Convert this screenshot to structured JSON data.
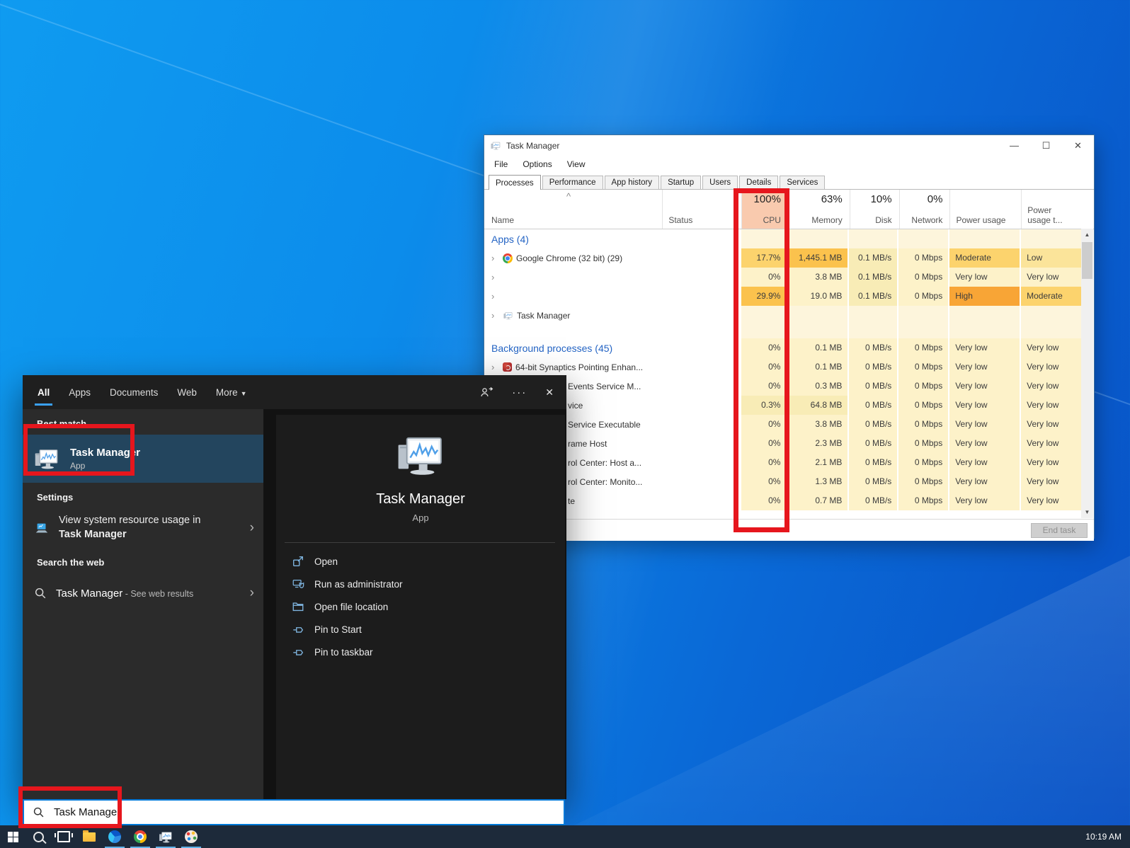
{
  "colors": {
    "accent_blue": "#0078d7",
    "annotation_red": "#e6161d",
    "selection_blue": "#23455e",
    "taskbar_bg": "#1d2a3a",
    "cpu_header_bg": "#f9caae",
    "heat_levels": {
      "empty": "#fdf5dc",
      "very_low": "#fdf2c9",
      "low2": "#f8ecb6",
      "low": "#fbe49a",
      "moderate": "#fcd36d",
      "strong": "#fbc24d",
      "high": "#f8a536"
    }
  },
  "task_manager": {
    "window_title": "Task Manager",
    "window_controls": {
      "minimize": "—",
      "maximize": "☐",
      "close": "✕"
    },
    "menu": [
      "File",
      "Options",
      "View"
    ],
    "tabs": [
      {
        "label": "Processes",
        "active": true
      },
      {
        "label": "Performance"
      },
      {
        "label": "App history"
      },
      {
        "label": "Startup"
      },
      {
        "label": "Users"
      },
      {
        "label": "Details"
      },
      {
        "label": "Services"
      }
    ],
    "columns": {
      "sort_indicator": "^",
      "name": "Name",
      "status": "Status",
      "cpu_pct": "100%",
      "cpu": "CPU",
      "memory_pct": "63%",
      "memory": "Memory",
      "disk_pct": "10%",
      "disk": "Disk",
      "network_pct": "0%",
      "network": "Network",
      "power": "Power usage",
      "power_trend": "Power usage t..."
    },
    "scrollbar": {
      "up": "▲",
      "down": "▼"
    },
    "rows": [
      {
        "kind": "section",
        "name": "Apps (4)",
        "cells": [
          [
            "",
            "l0"
          ],
          [
            "",
            "l0"
          ],
          [
            "",
            "l0"
          ],
          [
            "",
            "l0"
          ],
          [
            "",
            "l0"
          ],
          [
            "",
            "l0"
          ]
        ]
      },
      {
        "kind": "proc",
        "chevron": true,
        "icon": "chrome-icon",
        "name": "Google Chrome (32 bit) (29)",
        "cells": [
          [
            "17.7%",
            "l3"
          ],
          [
            "1,445.1 MB",
            "l4"
          ],
          [
            "0.1 MB/s",
            "l2"
          ],
          [
            "0 Mbps",
            "l1"
          ],
          [
            "Moderate",
            "l3"
          ],
          [
            "Low",
            "l25"
          ]
        ]
      },
      {
        "kind": "proc",
        "chevron": true,
        "name": "",
        "cells": [
          [
            "0%",
            "l1"
          ],
          [
            "3.8 MB",
            "l1"
          ],
          [
            "0.1 MB/s",
            "l2"
          ],
          [
            "0 Mbps",
            "l1"
          ],
          [
            "Very low",
            "l1"
          ],
          [
            "Very low",
            "l1"
          ]
        ]
      },
      {
        "kind": "proc",
        "chevron": true,
        "name": "",
        "cells": [
          [
            "29.9%",
            "l4"
          ],
          [
            "19.0 MB",
            "l1"
          ],
          [
            "0.1 MB/s",
            "l2"
          ],
          [
            "0 Mbps",
            "l1"
          ],
          [
            "High",
            "l5"
          ],
          [
            "Moderate",
            "l3"
          ]
        ]
      },
      {
        "kind": "proc",
        "chevron": true,
        "icon": "taskmgr-icon",
        "name": "Task Manager",
        "cells": [
          [
            "",
            "l0"
          ],
          [
            "",
            "l0"
          ],
          [
            "",
            "l0"
          ],
          [
            "",
            "l0"
          ],
          [
            "",
            "l0"
          ],
          [
            "",
            "l0"
          ]
        ]
      },
      {
        "kind": "spacer",
        "cells": [
          [
            "",
            "l0"
          ],
          [
            "",
            "l0"
          ],
          [
            "",
            "l0"
          ],
          [
            "",
            "l0"
          ],
          [
            "",
            "l0"
          ],
          [
            "",
            "l0"
          ]
        ]
      },
      {
        "kind": "section",
        "name": "Background processes (45)",
        "cells": [
          [
            "0%",
            "l1"
          ],
          [
            "0.1 MB",
            "l1"
          ],
          [
            "0 MB/s",
            "l1"
          ],
          [
            "0 Mbps",
            "l1"
          ],
          [
            "Very low",
            "l1"
          ],
          [
            "Very low",
            "l1"
          ]
        ]
      },
      {
        "kind": "proc",
        "chevron": true,
        "icon": "synaptics-icon",
        "name": "64-bit Synaptics Pointing Enhan...",
        "cells": [
          [
            "0%",
            "l1"
          ],
          [
            "0.1 MB",
            "l1"
          ],
          [
            "0 MB/s",
            "l1"
          ],
          [
            "0 Mbps",
            "l1"
          ],
          [
            "Very low",
            "l1"
          ],
          [
            "Very low",
            "l1"
          ]
        ]
      },
      {
        "kind": "proc",
        "clipped": true,
        "name": "Events Service M...",
        "cells": [
          [
            "0%",
            "l1"
          ],
          [
            "0.3 MB",
            "l1"
          ],
          [
            "0 MB/s",
            "l1"
          ],
          [
            "0 Mbps",
            "l1"
          ],
          [
            "Very low",
            "l1"
          ],
          [
            "Very low",
            "l1"
          ]
        ]
      },
      {
        "kind": "proc",
        "clipped": true,
        "name": "vice",
        "cells": [
          [
            "0.3%",
            "l2"
          ],
          [
            "64.8 MB",
            "l2"
          ],
          [
            "0 MB/s",
            "l1"
          ],
          [
            "0 Mbps",
            "l1"
          ],
          [
            "Very low",
            "l1"
          ],
          [
            "Very low",
            "l1"
          ]
        ]
      },
      {
        "kind": "proc",
        "clipped": true,
        "name": "Service Executable",
        "cells": [
          [
            "0%",
            "l1"
          ],
          [
            "3.8 MB",
            "l1"
          ],
          [
            "0 MB/s",
            "l1"
          ],
          [
            "0 Mbps",
            "l1"
          ],
          [
            "Very low",
            "l1"
          ],
          [
            "Very low",
            "l1"
          ]
        ]
      },
      {
        "kind": "proc",
        "clipped": true,
        "name": "rame Host",
        "cells": [
          [
            "0%",
            "l1"
          ],
          [
            "2.3 MB",
            "l1"
          ],
          [
            "0 MB/s",
            "l1"
          ],
          [
            "0 Mbps",
            "l1"
          ],
          [
            "Very low",
            "l1"
          ],
          [
            "Very low",
            "l1"
          ]
        ]
      },
      {
        "kind": "proc",
        "clipped": true,
        "name": "rol Center: Host a...",
        "cells": [
          [
            "0%",
            "l1"
          ],
          [
            "2.1 MB",
            "l1"
          ],
          [
            "0 MB/s",
            "l1"
          ],
          [
            "0 Mbps",
            "l1"
          ],
          [
            "Very low",
            "l1"
          ],
          [
            "Very low",
            "l1"
          ]
        ]
      },
      {
        "kind": "proc",
        "clipped": true,
        "name": "rol Center: Monito...",
        "cells": [
          [
            "0%",
            "l1"
          ],
          [
            "1.3 MB",
            "l1"
          ],
          [
            "0 MB/s",
            "l1"
          ],
          [
            "0 Mbps",
            "l1"
          ],
          [
            "Very low",
            "l1"
          ],
          [
            "Very low",
            "l1"
          ]
        ]
      },
      {
        "kind": "proc",
        "clipped": true,
        "name": "te",
        "cells": [
          [
            "0%",
            "l1"
          ],
          [
            "0.7 MB",
            "l1"
          ],
          [
            "0 MB/s",
            "l1"
          ],
          [
            "0 Mbps",
            "l1"
          ],
          [
            "Very low",
            "l1"
          ],
          [
            "Very low",
            "l1"
          ]
        ]
      }
    ],
    "end_task": "End task"
  },
  "search_panel": {
    "tabs": [
      {
        "label": "All",
        "active": true
      },
      {
        "label": "Apps"
      },
      {
        "label": "Documents"
      },
      {
        "label": "Web"
      },
      {
        "label": "More",
        "dropdown": true
      }
    ],
    "sections": {
      "best_match": "Best match",
      "settings": "Settings",
      "web": "Search the web"
    },
    "best_match": {
      "title": "Task Manager",
      "subtitle": "App"
    },
    "settings_item": {
      "text": "View system resource usage in ",
      "bold": "Task Manager"
    },
    "web_item": {
      "title": "Task Manager",
      "suffix": " - See web results"
    },
    "detail": {
      "title": "Task Manager",
      "subtitle": "App",
      "actions": [
        {
          "icon": "open-icon",
          "label": "Open"
        },
        {
          "icon": "run-as-admin-icon",
          "label": "Run as administrator"
        },
        {
          "icon": "open-file-location-icon",
          "label": "Open file location"
        },
        {
          "icon": "pin-to-start-icon",
          "label": "Pin to Start"
        },
        {
          "icon": "pin-to-taskbar-icon",
          "label": "Pin to taskbar"
        }
      ]
    }
  },
  "search_box": {
    "value": "Task Manager"
  },
  "taskbar": {
    "icons": [
      "start",
      "search",
      "task-view",
      "file-explorer",
      "blue-app",
      "chrome",
      "task-manager",
      "paint-app"
    ],
    "running": [
      "blue-app",
      "chrome",
      "task-manager",
      "paint-app"
    ],
    "clock": "10:19 AM"
  }
}
